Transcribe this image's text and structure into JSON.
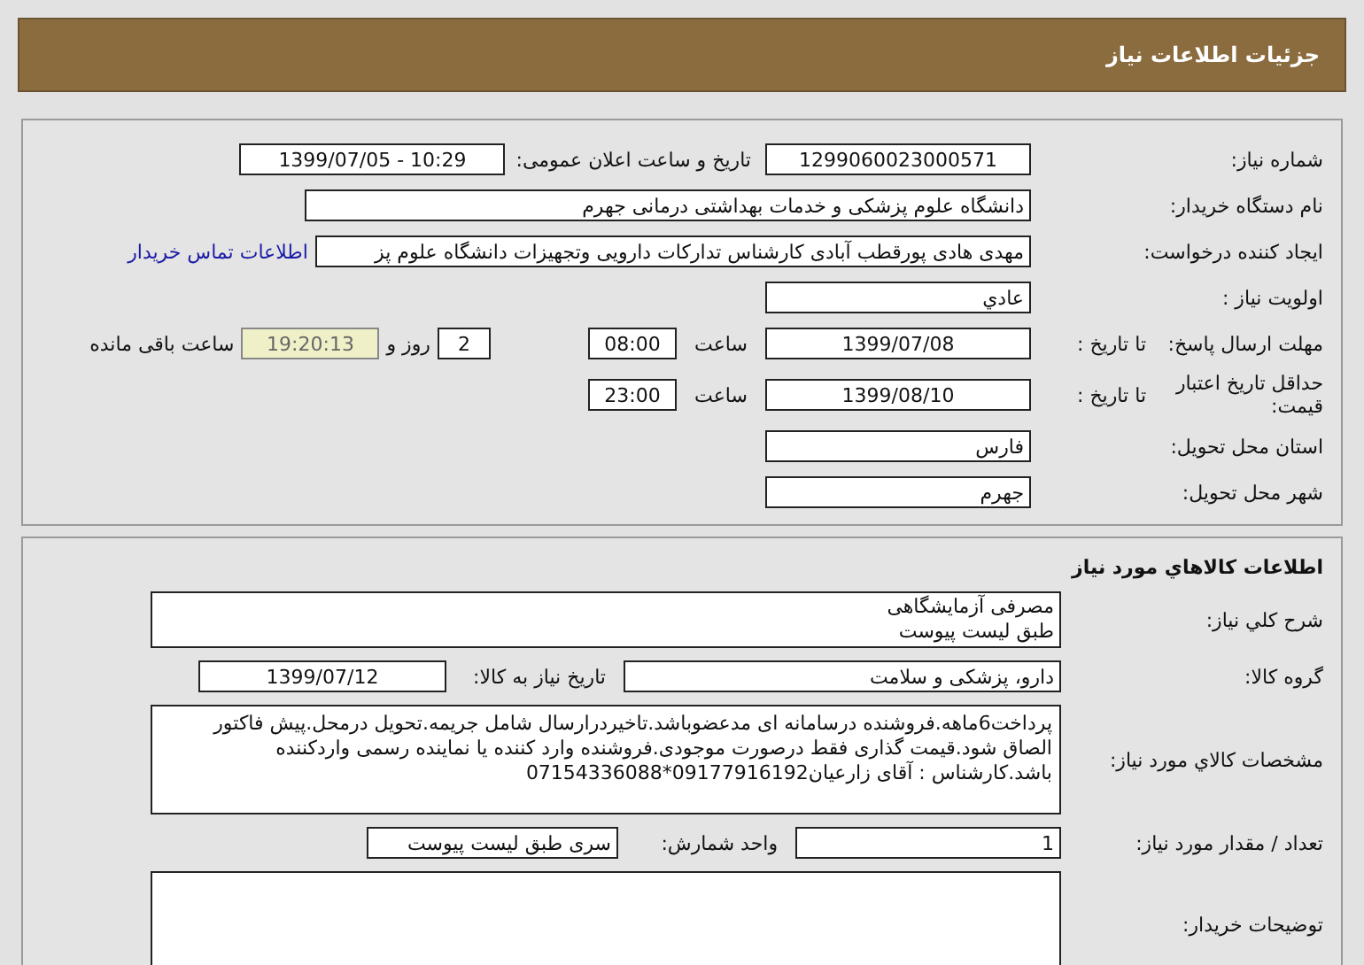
{
  "header": {
    "title": "جزئیات اطلاعات نیاز"
  },
  "need": {
    "need_number": {
      "label": "شماره نیاز:",
      "value": "1299060023000571"
    },
    "announce": {
      "label": "تاریخ و ساعت اعلان عمومی:",
      "value": "1399/07/05 - 10:29"
    },
    "buyer": {
      "label": "نام دستگاه خریدار:",
      "value": "دانشگاه علوم پزشکی و خدمات بهداشتی درمانی جهرم"
    },
    "requester": {
      "label": "ایجاد کننده درخواست:",
      "value": "مهدی هادی پورقطب آبادی کارشناس تدارکات دارویی وتجهیزات دانشگاه علوم پز",
      "link": "اطلاعات تماس خریدار"
    },
    "priority": {
      "label": "اولویت نیاز :",
      "value": "عادي"
    },
    "deadline": {
      "label": "مهلت ارسال پاسخ:",
      "date_label": "تا تاریخ :",
      "date": "1399/07/08",
      "time_label": "ساعت",
      "time": "08:00",
      "days": "2",
      "days_label": "روز و",
      "remaining": "19:20:13",
      "remaining_label": "ساعت باقی مانده"
    },
    "validity": {
      "label": "حداقل تاریخ اعتبار قیمت:",
      "date_label": "تا تاریخ :",
      "date": "1399/08/10",
      "time_label": "ساعت",
      "time": "23:00"
    },
    "province": {
      "label": "استان محل تحویل:",
      "value": "فارس"
    },
    "city": {
      "label": "شهر محل تحویل:",
      "value": "جهرم"
    }
  },
  "goods": {
    "title": "اطلاعات کالاهاي مورد نیاز",
    "summary": {
      "label": "شرح کلي نیاز:",
      "lines": [
        "مصرفی آزمایشگاهی",
        "طبق لیست پیوست"
      ]
    },
    "group": {
      "label": "گروه کالا:",
      "value": "دارو، پزشکی و سلامت"
    },
    "need_date": {
      "label": "تاریخ نیاز به کالا:",
      "value": "1399/07/12"
    },
    "specs": {
      "label": "مشخصات کالاي مورد نیاز:",
      "value": "پرداخت6ماهه.فروشنده درسامانه ای مدعضوباشد.تاخیردرارسال شامل جریمه.تحویل درمحل.پیش فاکتور الصاق شود.قیمت گذاری فقط درصورت موجودی.فروشنده وارد کننده یا نماینده رسمی واردکننده باشد.کارشناس : آقای زارعیان09177916192*07154336088"
    },
    "quantity": {
      "label": "تعداد / مقدار مورد نیاز:",
      "value": "1"
    },
    "unit": {
      "label": "واحد شمارش:",
      "value": "سری طبق لیست پیوست"
    },
    "notes": {
      "label": "توضیحات خریدار:"
    }
  }
}
